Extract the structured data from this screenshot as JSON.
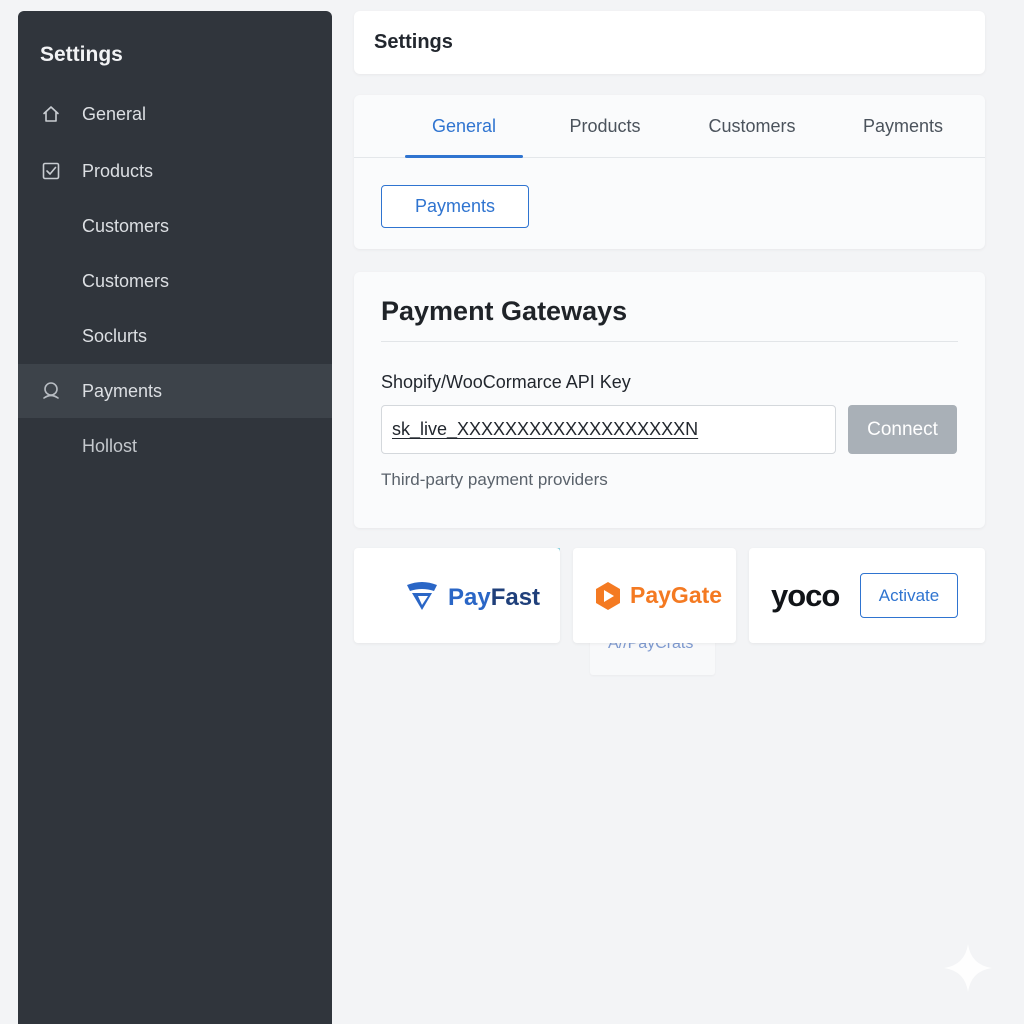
{
  "sidebar": {
    "title": "Settings",
    "items": [
      {
        "label": "General",
        "icon": "home-icon"
      },
      {
        "label": "Products",
        "icon": "checkbox-icon"
      },
      {
        "label": "Customers",
        "icon": ""
      },
      {
        "label": "Customers",
        "icon": ""
      },
      {
        "label": "Soclurts",
        "icon": ""
      },
      {
        "label": "Payments",
        "icon": "user-icon",
        "active": true
      },
      {
        "label": "Hollost",
        "icon": ""
      }
    ]
  },
  "header": {
    "title": "Settings"
  },
  "tabs": {
    "items": [
      {
        "label": "General",
        "active": true
      },
      {
        "label": "Products"
      },
      {
        "label": "Customers"
      },
      {
        "label": "Payments"
      }
    ],
    "sub_button": "Payments"
  },
  "gateways": {
    "title": "Payment Gateways",
    "api_key_label": "Shopify/WooCormarce API Key",
    "api_key_value": "sk_live_XXXXXXXXXXXXXXXXXXXN",
    "connect_label": "Connect",
    "helper_text": "Third-party payment providers"
  },
  "providers": {
    "payfast": {
      "name_pre": "Pay",
      "name_post": "Fast"
    },
    "paygate": {
      "name": "PayGate"
    },
    "yoco": {
      "name": "yoco",
      "activate_label": "Activate"
    },
    "ghost": {
      "name": "A//PayCrats"
    }
  },
  "colors": {
    "accent": "#2f74d0",
    "sidebar_bg": "#30353c",
    "paygate_orange": "#f47a22",
    "payfast_blue": "#2a66c6",
    "payfast_navy": "#1f3f7a"
  }
}
